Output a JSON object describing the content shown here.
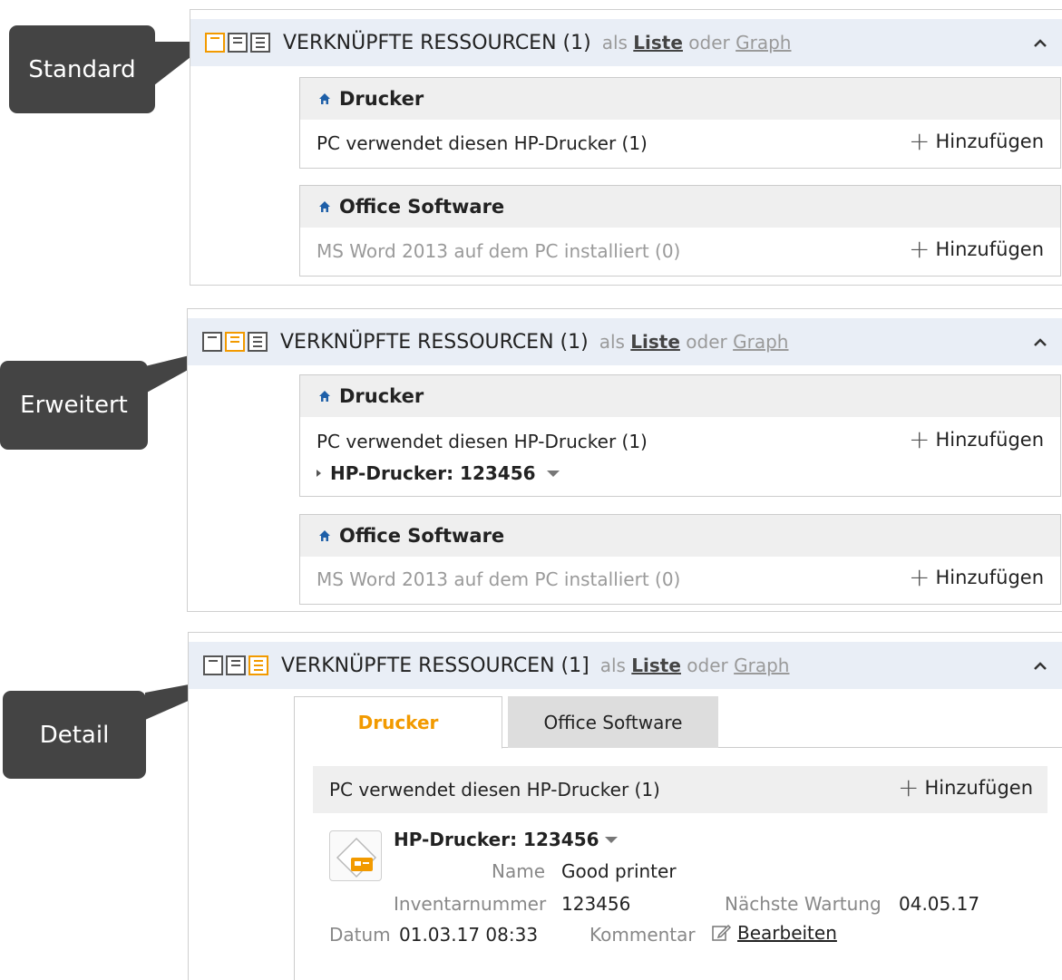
{
  "callouts": {
    "standard": "Standard",
    "erweitert": "Erweitert",
    "detail": "Detail"
  },
  "header": {
    "title": "VERKNÜPFTE RESSOURCEN (1)",
    "title_detail": "VERKNÜPFTE RESSOURCEN (1]",
    "als": "als",
    "liste": "Liste",
    "oder": "oder",
    "graph": "Graph"
  },
  "icons": {
    "view_standard": "standard-view-icon",
    "view_extended": "extended-view-icon",
    "view_detail": "detail-view-icon",
    "collapse": "chevron-up-icon",
    "category": "house-icon",
    "add": "plus-icon",
    "expand": "triangle-right-icon",
    "menu": "triangle-down-icon",
    "device": "printer-device-icon",
    "edit": "pencil-edit-icon"
  },
  "colors": {
    "accent": "#f29a00",
    "header_bg": "#e9eef6",
    "callout_bg": "#444444",
    "category_icon": "#1e5fa8"
  },
  "groups": {
    "drucker": {
      "title": "Drucker",
      "relation": "PC verwendet diesen HP-Drucker (1)",
      "add": "Hinzufügen",
      "item": "HP-Drucker: 123456"
    },
    "office": {
      "title": "Office Software",
      "relation": "MS Word 2013 auf dem PC installiert (0)",
      "add": "Hinzufügen"
    }
  },
  "detail": {
    "tabs": [
      "Drucker",
      "Office Software"
    ],
    "relation": "PC verwendet diesen HP-Drucker (1)",
    "add": "Hinzufügen",
    "item_title": "HP-Drucker: 123456",
    "fields": {
      "name_label": "Name",
      "name_value": "Good printer",
      "inventar_label": "Inventarnummer",
      "inventar_value": "123456",
      "wartung_label": "Nächste Wartung",
      "wartung_value": "04.05.17",
      "datum_label": "Datum",
      "datum_value": "01.03.17 08:33",
      "kommentar_label": "Kommentar",
      "edit_label": "Bearbeiten"
    }
  }
}
